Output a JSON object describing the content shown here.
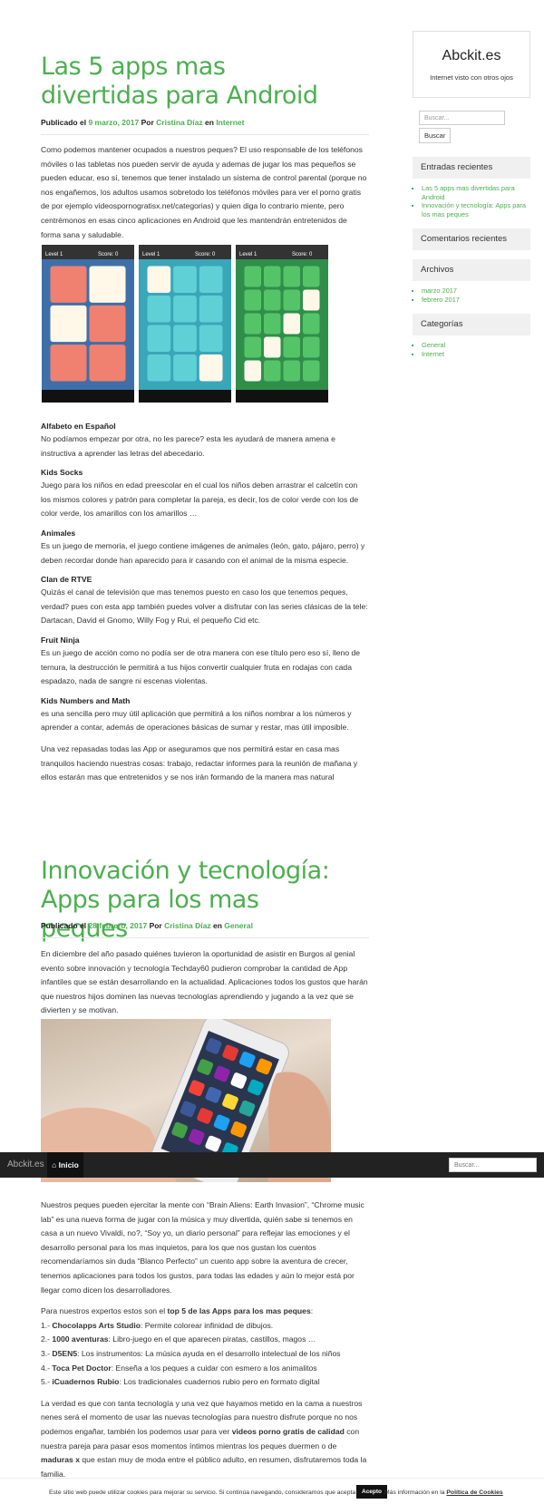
{
  "post1": {
    "title": "Las 5 apps mas divertidas para Android",
    "meta_prefix": "Publicado el",
    "date": "9 marzo, 2017",
    "by": "Por",
    "author": "Cristina Díaz",
    "in": "en",
    "category": "Internet",
    "intro": "Como podemos mantener ocupados a nuestros peques? El uso responsable de los teléfonos móviles o las tabletas nos pueden servir de ayuda y ademas de jugar los mas pequeños se pueden educar, eso sí, tenemos que tener instalado un sistema de control parental (porque no nos engañemos, los adultos usamos sobretodo los teléfonos móviles para ver el porno gratis de por ejemplo videospornogratisx.net/categorias) y quien diga lo contrario miente, pero centrémonos en esas cinco aplicaciones en Android que les mantendrán entretenidos de forma sana y saludable.",
    "game_screens": [
      {
        "level": "Level 1",
        "score": "Score: 0"
      },
      {
        "level": "Level 1",
        "score": "Score: 0"
      },
      {
        "level": "Level 1",
        "score": "Score: 0"
      }
    ],
    "apps": [
      {
        "name": "Alfabeto en Español",
        "desc": "No podíamos empezar por otra, no les parece? esta les ayudará de manera amena e instructiva a aprender las letras del abecedario."
      },
      {
        "name": "Kids Socks",
        "desc": "Juego para los niños en edad preescolar en el cual los niños deben arrastrar el calcetín con los mismos colores y patrón para completar la pareja, es decir, los de color verde con los de color verde, los amarillos con los amarillos …"
      },
      {
        "name": "Animales",
        "desc": "Es un juego de memoria, el juego contiene imágenes de animales (león, gato, pájaro, perro) y deben recordar donde han aparecido para ir casando con el animal de la misma especie."
      },
      {
        "name": "Clan de RTVE",
        "desc": "Quizás el canal de televisión que mas tenemos puesto en caso los que tenemos peques, verdad? pues con esta app también puedes volver a disfrutar con las series clásicas de la tele: Dartacan, David el Gnomo, Willy Fog y Rui, el pequeño Cid etc."
      },
      {
        "name": "Fruit Ninja",
        "desc": "Es un juego de acción como no podía ser de otra manera con ese título pero eso sí, lleno de ternura, la destrucción le permitirá a tus hijos convertir cualquier fruta en rodajas con cada espadazo, nada de sangre ni escenas violentas."
      }
    ],
    "kids_numbers_name": "Kids Numbers and Math",
    "kids_numbers_desc": " es una sencilla pero muy útil aplicación que permitirá a los niños nombrar a los números y aprender a contar, además de operaciones básicas de sumar y restar, mas útil imposible.",
    "outro": "Una vez repasadas todas las App or aseguramos que nos permitirá estar en casa mas tranquilos haciendo nuestras cosas: trabajo, redactar informes para la reunión de mañana y ellos estarán mas que entretenidos y se nos irán formando de la manera mas natural"
  },
  "post2": {
    "title": "Innovación y tecnología: Apps para los mas peques",
    "meta_prefix": "Publicado el",
    "date": "28 febrero, 2017",
    "by": "Por",
    "author": "Cristina Díaz",
    "in": "en",
    "category": "General",
    "intro": "En diciembre del año pasado quiénes tuvieron la oportunidad de asistir en Burgos al genial evento sobre innovación y tecnología Techday60 pudieron comprobar la cantidad de App infantiles que se están desarrollando en la actualidad. Aplicaciones todos los gustos que harán que nuestros hijos dominen las nuevas tecnologías aprendiendo y jugando a la vez que se divierten y se motivan.",
    "para2": "Nuestros peques pueden ejercitar la mente con “Brain Aliens: Earth Invasion”, “Chrome music lab” es una nueva forma de jugar con la música y muy divertida, quién sabe si tenemos en casa a un nuevo Vivaldi, no?, “Soy yo, un diario personal” para reflejar las emociones  y el desarrollo personal para los mas inquietos, para los que nos gustan los cuentos recomendaríamos sin duda “Blanco Perfecto” un cuento app sobre la aventura de crecer, tenemos aplicaciones para todos los gustos, para todas las edades y aún lo mejor está por llegar como dicen los desarrolladores.",
    "top_intro": "Para nuestros expertos estos son el ",
    "top_bold": "top 5 de las Apps para los mas peques",
    "top_colon": ":",
    "top_list": [
      {
        "num": "1.- ",
        "name": "Chocolapps Arts Studio",
        "desc": ": Permite colorear infinidad de dibujos."
      },
      {
        "num": "2.- ",
        "name": "1000 aventuras",
        "desc": ": Libro-juego en el que aparecen piratas, castillos, magos …"
      },
      {
        "num": "3.- ",
        "name": "D5EN5",
        "desc": ": Los instrumentos: La música ayuda en el desarrollo intelectual de los niños"
      },
      {
        "num": "4.- ",
        "name": "Toca Pet Doctor",
        "desc": ": Enseña a los peques a cuidar con esmero a los animalitos"
      },
      {
        "num": "5.- ",
        "name": "iCuadernos Rubio",
        "desc": ": Los tradicionales cuadernos rubio pero en formato digital"
      }
    ],
    "final_a": "La verdad es que con tanta tecnología y una vez que hayamos metido en la cama a nuestros nenes será el momento de usar las nuevas tecnologías para nuestro disfrute porque no nos podemos engañar, también los podemos usar para ver ",
    "final_b": "videos porno gratis de calidad",
    "final_c": " con nuestra pareja para pasar esos momentos íntimos mientras los peques duermen o de ",
    "final_d": "maduras x",
    "final_e": " que estan muy de moda entre el público adulto, en resumen, disfrutaremos toda la familia."
  },
  "sidebar": {
    "site_name": "Abckit.es",
    "site_desc": "Internet visto con otros ojos",
    "search_placeholder": "Buscar...",
    "search_button": "Buscar",
    "recent_title": "Entradas recientes",
    "recent": [
      "Las 5 apps mas divertidas para Android",
      "Innovación y tecnología: Apps para los mas peques"
    ],
    "comments_title": "Comentarios recientes",
    "archives_title": "Archivos",
    "archives": [
      "marzo 2017",
      "febrero 2017"
    ],
    "categories_title": "Categorías",
    "categories": [
      "General",
      "Internet"
    ]
  },
  "navbar": {
    "brand": "Abckit.es",
    "home": "Inicio",
    "search_placeholder": "Buscar..."
  },
  "cookie": {
    "text": "Este sitio web puede utilizar cookies para mejorar su servicio. Si continúa navegando, consideramos que acepta su uso.",
    "accept": "Acepto",
    "more": "Más información en la ",
    "policy": "Política de Cookies"
  },
  "colors": {
    "accent": "#4caf50",
    "navbar": "#222222"
  }
}
